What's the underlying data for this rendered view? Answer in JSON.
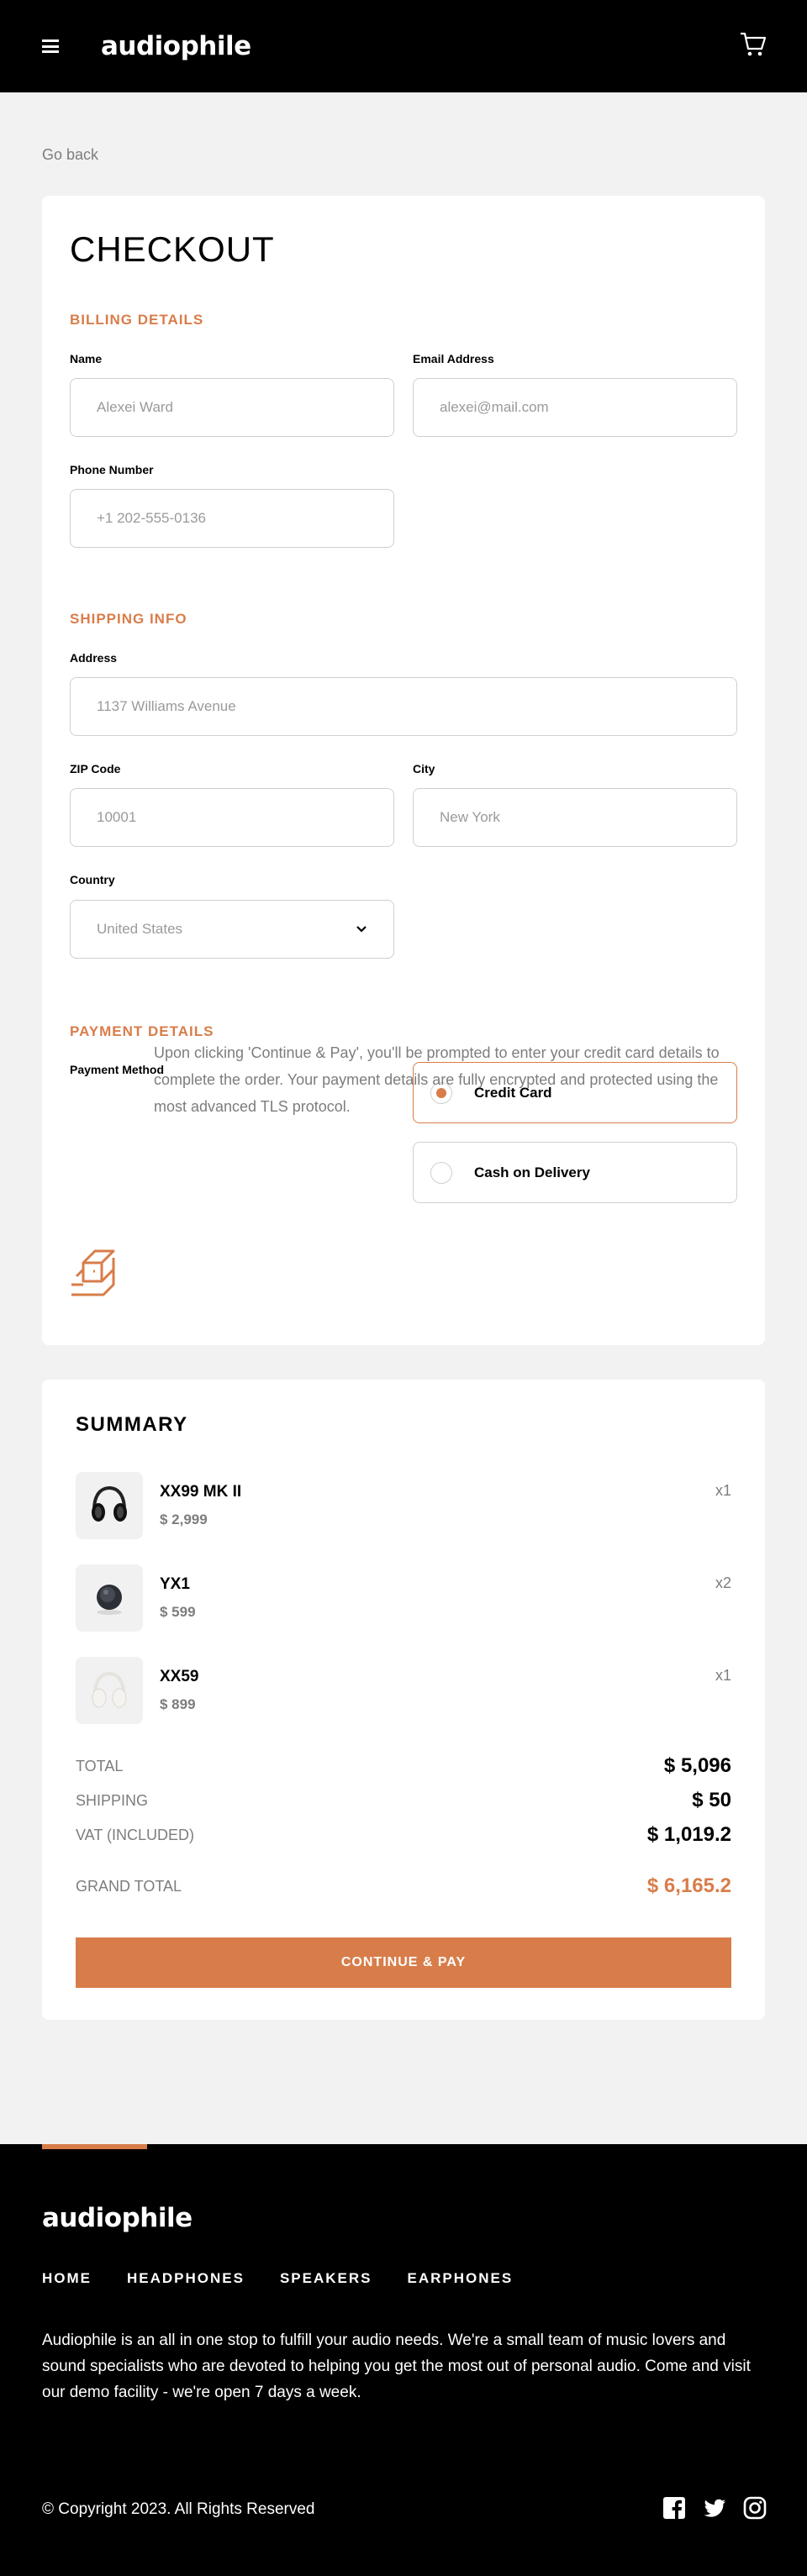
{
  "header": {
    "logo": "audiophile"
  },
  "nav": {
    "go_back": "Go back"
  },
  "checkout": {
    "title": "CHECKOUT",
    "billing": {
      "title": "BILLING DETAILS",
      "name_label": "Name",
      "name_placeholder": "Alexei Ward",
      "email_label": "Email Address",
      "email_placeholder": "alexei@mail.com",
      "phone_label": "Phone Number",
      "phone_placeholder": "+1 202-555-0136"
    },
    "shipping": {
      "title": "SHIPPING INFO",
      "address_label": "Address",
      "address_placeholder": "1137 Williams Avenue",
      "zip_label": "ZIP Code",
      "zip_placeholder": "10001",
      "city_label": "City",
      "city_placeholder": "New York",
      "country_label": "Country",
      "country_value": "United States"
    },
    "payment": {
      "title": "PAYMENT DETAILS",
      "method_label": "Payment Method",
      "options": [
        "Credit Card",
        "Cash on Delivery"
      ],
      "selected": "Credit Card",
      "note": "Upon clicking 'Continue & Pay', you'll be prompted to enter your credit card details to complete the order. Your payment details are fully encrypted and protected using the most advanced TLS protocol."
    }
  },
  "summary": {
    "title": "SUMMARY",
    "items": [
      {
        "name": "XX99 MK II",
        "price": "$ 2,999",
        "qty": "x1",
        "icon": "headphones-black-icon"
      },
      {
        "name": "YX1",
        "price": "$ 599",
        "qty": "x2",
        "icon": "earphones-icon"
      },
      {
        "name": "XX59",
        "price": "$ 899",
        "qty": "x1",
        "icon": "headphones-white-icon"
      }
    ],
    "total_label": "TOTAL",
    "total_value": "$ 5,096",
    "shipping_label": "SHIPPING",
    "shipping_value": "$ 50",
    "vat_label": "VAT (INCLUDED)",
    "vat_value": "$ 1,019.2",
    "grand_label": "GRAND TOTAL",
    "grand_value": "$ 6,165.2",
    "continue_button": "CONTINUE & PAY"
  },
  "footer": {
    "logo": "audiophile",
    "nav": [
      "HOME",
      "HEADPHONES",
      "SPEAKERS",
      "EARPHONES"
    ],
    "description": "Audiophile is an all in one stop to fulfill your audio needs. We're a small team of music lovers and sound specialists who are devoted to helping you get the most out of personal audio. Come and visit our demo facility - we're open 7 days a week.",
    "copyright": "© Copyright 2023. All Rights Reserved",
    "socials": [
      "facebook-icon",
      "twitter-icon",
      "instagram-icon"
    ]
  },
  "colors": {
    "accent": "#d87d4a",
    "dark": "#000000",
    "muted": "#7d7d7d",
    "bg": "#f2f2f2"
  }
}
